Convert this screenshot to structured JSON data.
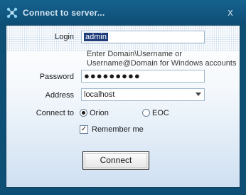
{
  "window": {
    "title": "Connect to server...",
    "close_glyph": "x",
    "icon": "server-connection-icon"
  },
  "form": {
    "login_label": "Login",
    "login_value": "admin",
    "hint_line1": "Enter Domain\\Username or",
    "hint_line2": "Username@Domain for Windows accounts",
    "password_label": "Password",
    "password_mask": "●●●●●●●●●",
    "address_label": "Address",
    "address_value": "localhost",
    "connect_to_label": "Connect to",
    "option_orion": "Orion",
    "option_eoc": "EOC",
    "selected_option": "Orion",
    "remember_label": "Remember me",
    "remember_checked": true,
    "check_glyph": "✓",
    "connect_button": "Connect"
  },
  "colors": {
    "title_bg": "#0e4f76",
    "selection_bg": "#1f3d7a"
  }
}
